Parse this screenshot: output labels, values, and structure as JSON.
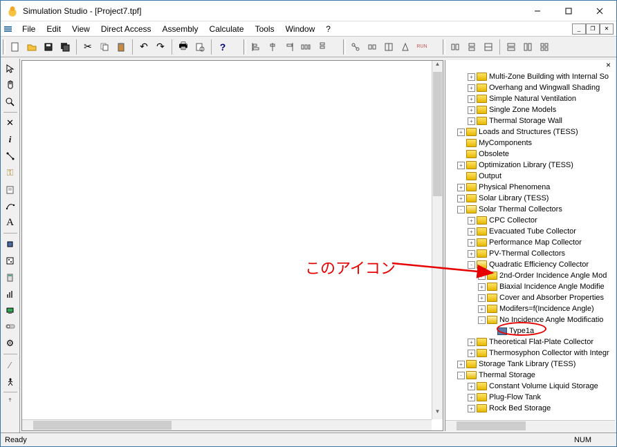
{
  "window": {
    "title": "Simulation Studio - [Project7.tpf]"
  },
  "menu": {
    "items": [
      "File",
      "Edit",
      "View",
      "Direct Access",
      "Assembly",
      "Calculate",
      "Tools",
      "Window",
      "?"
    ]
  },
  "status": {
    "ready": "Ready",
    "num": "NUM"
  },
  "annotation": {
    "text": "このアイコン"
  },
  "tree": [
    {
      "depth": 2,
      "exp": "+",
      "icon": "folder",
      "label": "Multi-Zone Building with Internal So"
    },
    {
      "depth": 2,
      "exp": "+",
      "icon": "folder",
      "label": "Overhang and Wingwall Shading"
    },
    {
      "depth": 2,
      "exp": "+",
      "icon": "folder",
      "label": "Simple Natural Ventilation"
    },
    {
      "depth": 2,
      "exp": "+",
      "icon": "folder",
      "label": "Single Zone Models"
    },
    {
      "depth": 2,
      "exp": "+",
      "icon": "folder",
      "label": "Thermal Storage Wall"
    },
    {
      "depth": 1,
      "exp": "+",
      "icon": "folder",
      "label": "Loads and Structures (TESS)"
    },
    {
      "depth": 1,
      "exp": "",
      "icon": "folder",
      "label": "MyComponents"
    },
    {
      "depth": 1,
      "exp": "",
      "icon": "folder",
      "label": "Obsolete"
    },
    {
      "depth": 1,
      "exp": "+",
      "icon": "folder",
      "label": "Optimization Library (TESS)"
    },
    {
      "depth": 1,
      "exp": "",
      "icon": "folder",
      "label": "Output"
    },
    {
      "depth": 1,
      "exp": "+",
      "icon": "folder",
      "label": "Physical Phenomena"
    },
    {
      "depth": 1,
      "exp": "+",
      "icon": "folder",
      "label": "Solar Library (TESS)"
    },
    {
      "depth": 1,
      "exp": "-",
      "icon": "folder-open",
      "label": "Solar Thermal Collectors"
    },
    {
      "depth": 2,
      "exp": "+",
      "icon": "folder",
      "label": "CPC Collector"
    },
    {
      "depth": 2,
      "exp": "+",
      "icon": "folder",
      "label": "Evacuated Tube Collector"
    },
    {
      "depth": 2,
      "exp": "+",
      "icon": "folder",
      "label": "Performance Map Collector"
    },
    {
      "depth": 2,
      "exp": "+",
      "icon": "folder",
      "label": "PV-Thermal Collectors"
    },
    {
      "depth": 2,
      "exp": "-",
      "icon": "folder-open",
      "label": "Quadratic Efficiency Collector"
    },
    {
      "depth": 3,
      "exp": "+",
      "icon": "folder",
      "label": "2nd-Order Incidence Angle Mod"
    },
    {
      "depth": 3,
      "exp": "+",
      "icon": "folder",
      "label": "Biaxial Incidence Angle Modifie"
    },
    {
      "depth": 3,
      "exp": "+",
      "icon": "folder",
      "label": "Cover and Absorber Properties"
    },
    {
      "depth": 3,
      "exp": "+",
      "icon": "folder",
      "label": "Modifers=f(Incidence Angle)"
    },
    {
      "depth": 3,
      "exp": "-",
      "icon": "folder-open",
      "label": "No Incidence Angle Modificatio"
    },
    {
      "depth": 4,
      "exp": "",
      "icon": "comp",
      "label": "Type1a",
      "circled": true
    },
    {
      "depth": 2,
      "exp": "+",
      "icon": "folder",
      "label": "Theoretical Flat-Plate Collector"
    },
    {
      "depth": 2,
      "exp": "+",
      "icon": "folder",
      "label": "Thermosyphon Collector with Integr"
    },
    {
      "depth": 1,
      "exp": "+",
      "icon": "folder",
      "label": "Storage Tank Library (TESS)"
    },
    {
      "depth": 1,
      "exp": "-",
      "icon": "folder-open",
      "label": "Thermal Storage"
    },
    {
      "depth": 2,
      "exp": "+",
      "icon": "folder",
      "label": "Constant Volume Liquid Storage"
    },
    {
      "depth": 2,
      "exp": "+",
      "icon": "folder",
      "label": "Plug-Flow Tank"
    },
    {
      "depth": 2,
      "exp": "+",
      "icon": "folder",
      "label": "Rock Bed Storage"
    }
  ]
}
